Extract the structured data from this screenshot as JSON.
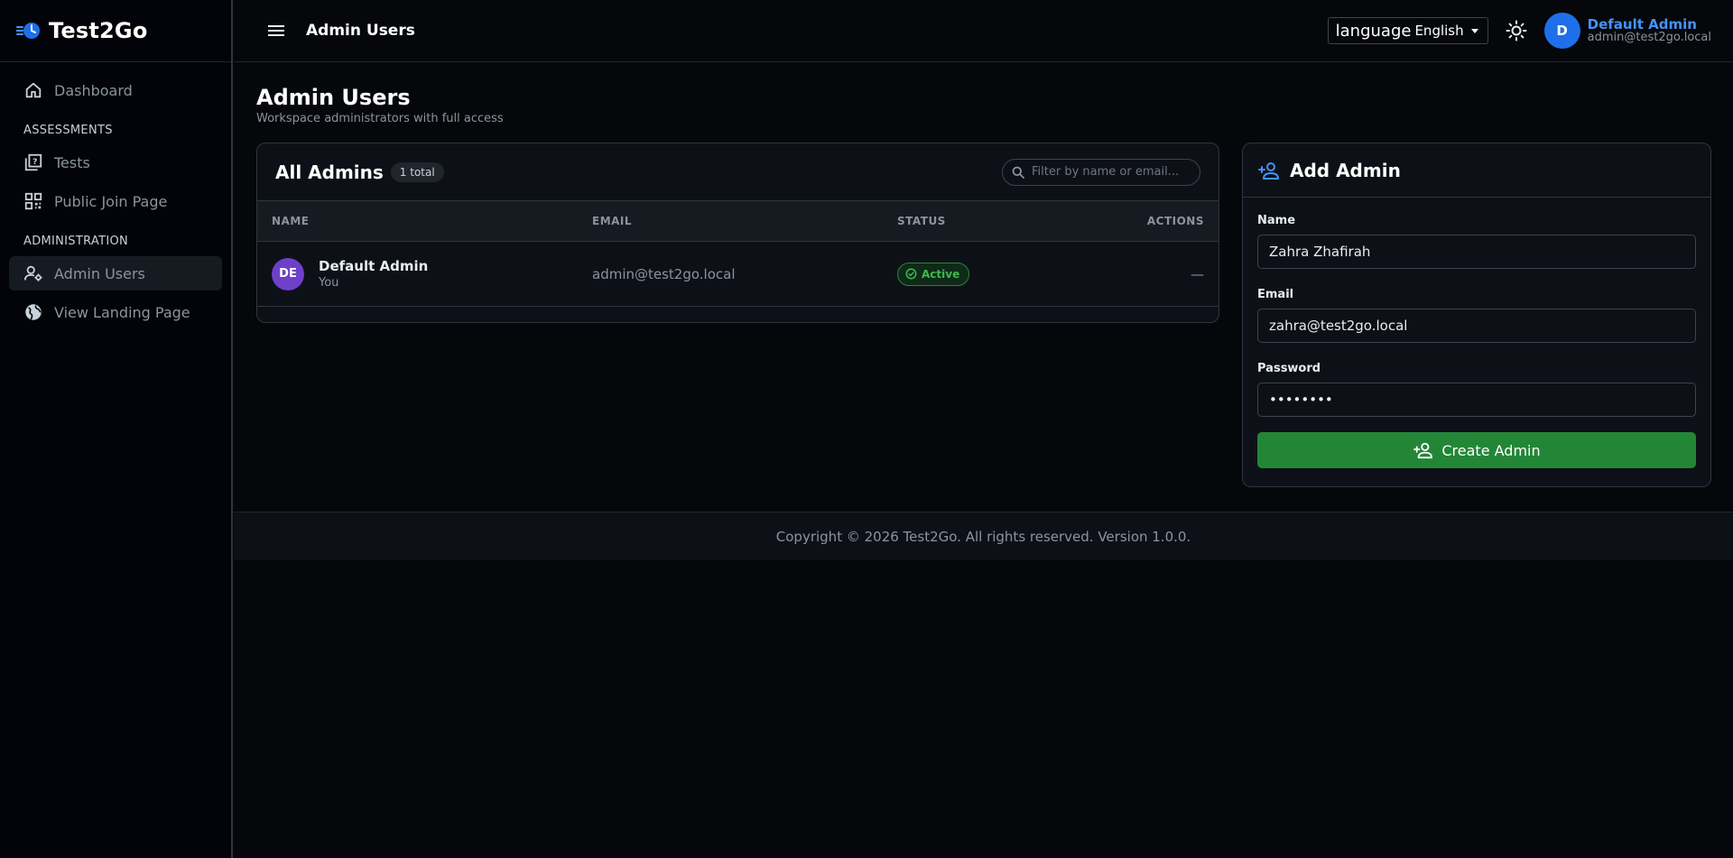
{
  "app": {
    "name": "Test2Go"
  },
  "sidebar": {
    "items": [
      {
        "label": "Dashboard",
        "icon": "home-icon"
      },
      {
        "section": "ASSESSMENTS"
      },
      {
        "label": "Tests",
        "icon": "quiz-icon"
      },
      {
        "label": "Public Join Page",
        "icon": "qr-code-icon"
      },
      {
        "section": "ADMINISTRATION"
      },
      {
        "label": "Admin Users",
        "icon": "manage-accounts-icon",
        "active": true
      },
      {
        "label": "View Landing Page",
        "icon": "globe-icon"
      }
    ]
  },
  "topbar": {
    "title": "Admin Users",
    "language": {
      "icon_text": "language",
      "value": "English"
    },
    "user": {
      "initial": "D",
      "name": "Default Admin",
      "email": "admin@test2go.local"
    }
  },
  "page": {
    "title": "Admin Users",
    "subtitle": "Workspace administrators with full access"
  },
  "admins": {
    "title": "All Admins",
    "count": "1 total",
    "filter_placeholder": "Filter by name or email...",
    "columns": [
      "NAME",
      "EMAIL",
      "STATUS",
      "ACTIONS"
    ],
    "rows": [
      {
        "initials": "DE",
        "name": "Default Admin",
        "sub": "You",
        "email": "admin@test2go.local",
        "status": "Active",
        "actions": "—"
      }
    ]
  },
  "add_admin": {
    "title": "Add Admin",
    "name_label": "Name",
    "name_value": "Zahra Zhafirah",
    "email_label": "Email",
    "email_value": "zahra@test2go.local",
    "password_label": "Password",
    "password_value": "••••••••",
    "submit_label": "Create Admin"
  },
  "footer": {
    "text": "Copyright © 2026 Test2Go. All rights reserved. Version 1.0.0."
  },
  "colors": {
    "accent": "#1f6feb",
    "success": "#238636",
    "avatar_purple": "#6e40c9",
    "background": "#05070b"
  }
}
